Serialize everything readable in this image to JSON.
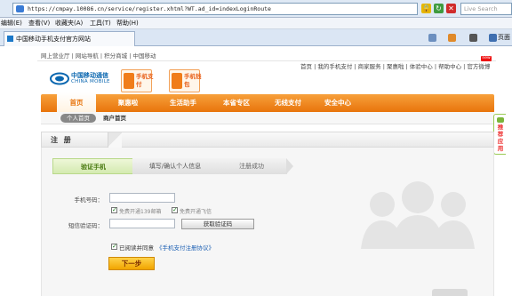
{
  "browser": {
    "url": "https://cmpay.10086.cn/service/register.xhtml?WT.ad_id=indexLoginRoute",
    "search_placeholder": "Live Search",
    "menu": [
      "编辑(E)",
      "查看(V)",
      "收藏夹(A)",
      "工具(T)",
      "帮助(H)"
    ],
    "tab_title": "中国移动手机支付官方网站",
    "toolbar_page_label": "页面"
  },
  "site": {
    "top_links": "网上营业厅 | 网站导航 | 积分商城 | 中国移动",
    "logo_cn": "中国移动通信",
    "logo_en": "CHINA MOBILE",
    "feature1": "手机支付",
    "feature2": "手机钱包",
    "right_links": "首页 | 我的手机支付 | 商家服务 | 聚惠啦 | 体验中心 | 帮助中心 | 官方微博",
    "new_badge": "new",
    "nav": [
      "首页",
      "聚惠啦",
      "生活助手",
      "本省专区",
      "无线支付",
      "安全中心"
    ],
    "subnav_pill": "个人首页",
    "subnav_link": "商户首页",
    "side_tab": "推荐应用"
  },
  "register": {
    "title": "注 册",
    "steps": [
      "验证手机",
      "填写/确认个人信息",
      "注册成功"
    ],
    "phone_label": "手机号码：",
    "opt1": "免费开通139邮箱",
    "opt2": "免费开通飞信",
    "sms_label": "短信验证码：",
    "get_code": "获取验证码",
    "agree_text": "已阅读并同意",
    "agreement_link": "《手机支付注册协议》",
    "next": "下一步"
  },
  "colors": {
    "brand_orange": "#f0820f",
    "step_active": "#d4eab0",
    "link_blue": "#1b5fb3"
  }
}
